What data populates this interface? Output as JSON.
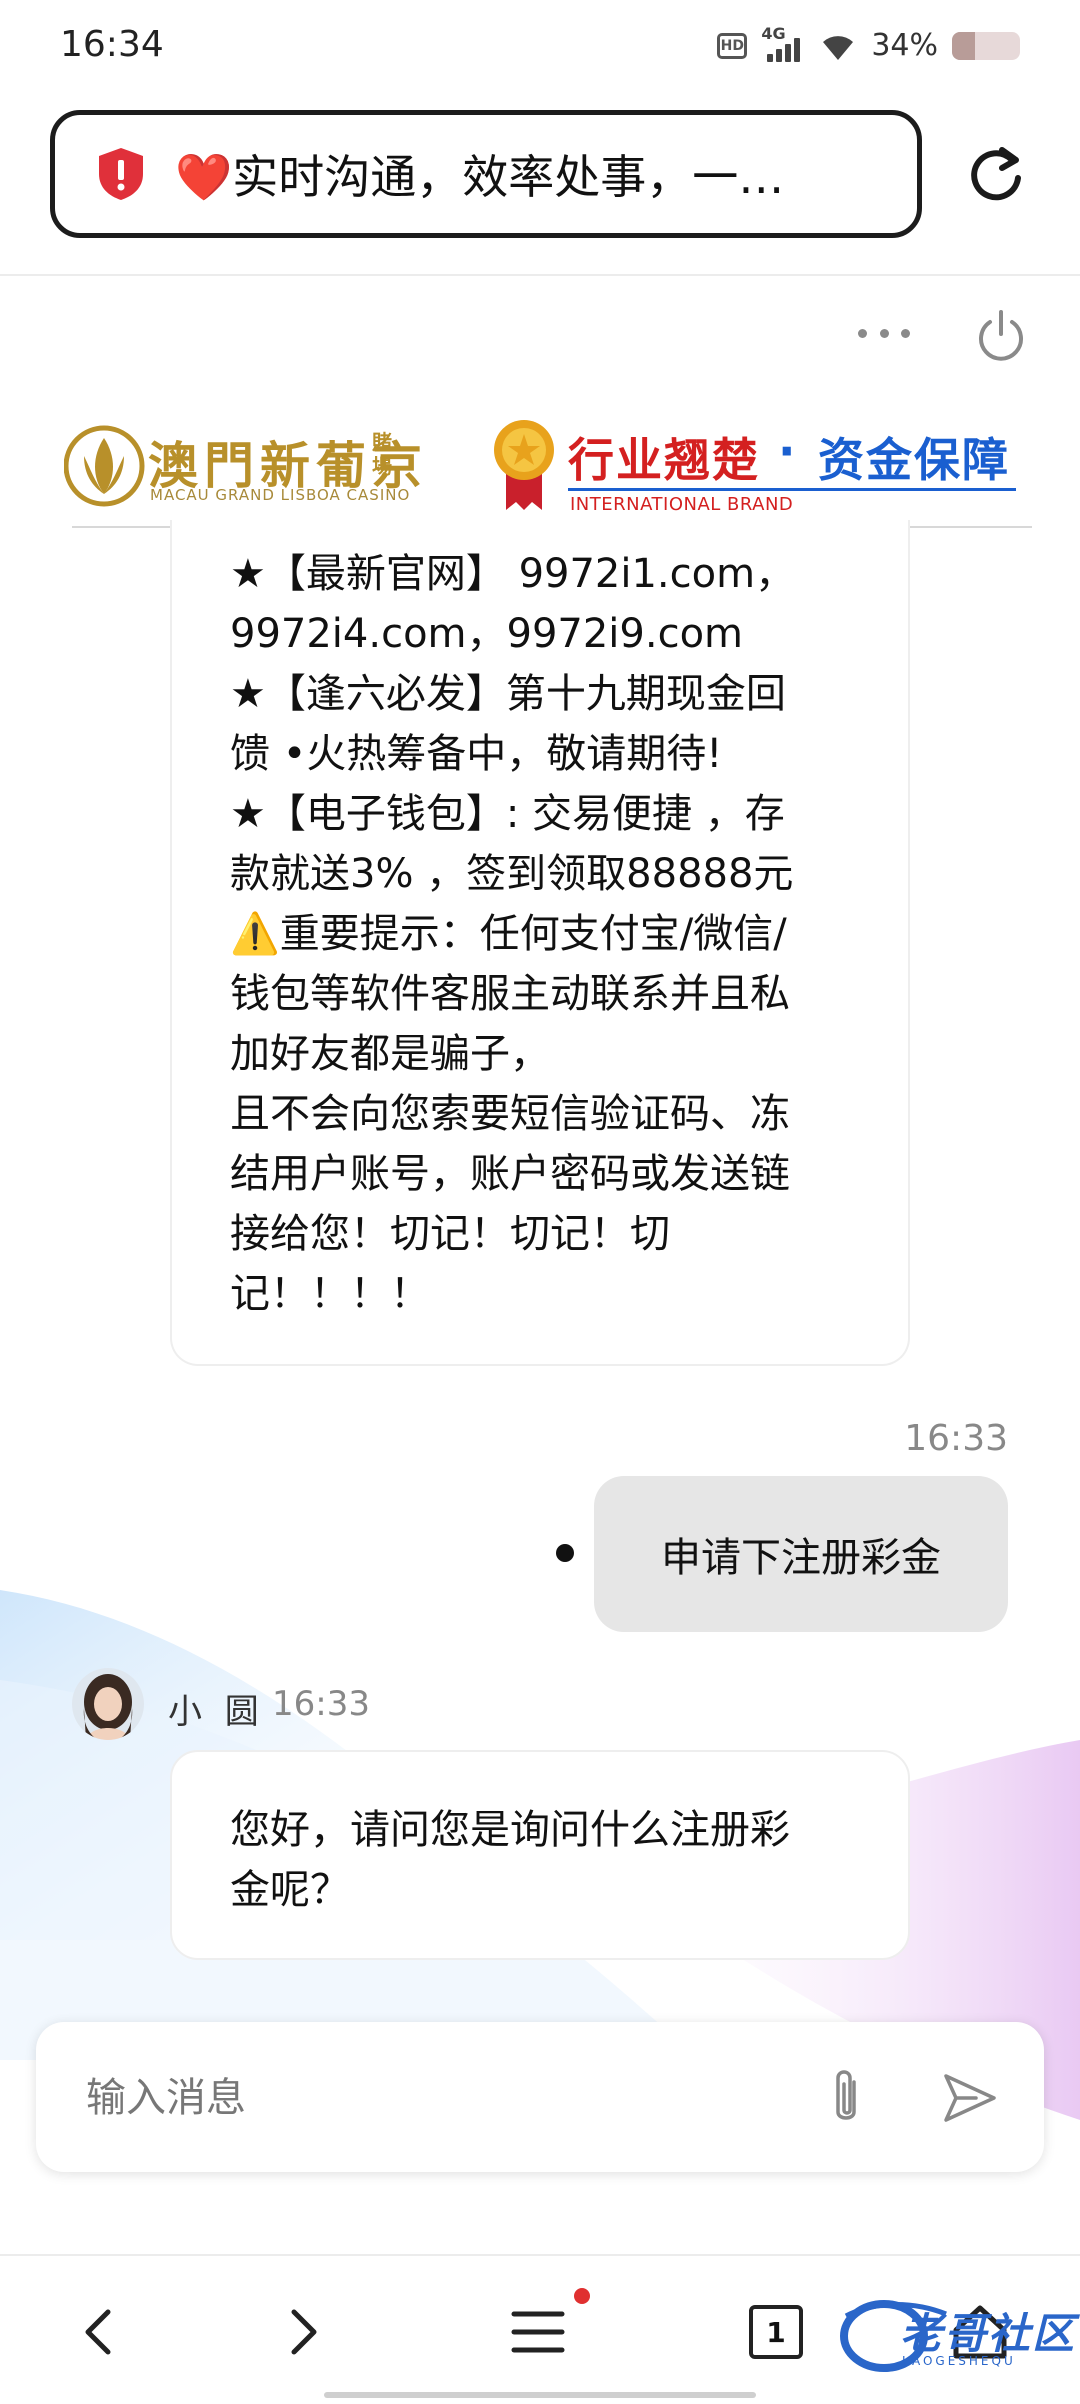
{
  "status_bar": {
    "time": "16:34",
    "hd": "HD",
    "network": "4G",
    "battery_percent": "34%",
    "battery_level": 0.34
  },
  "browser": {
    "url_heart": "❤️",
    "url_text": "实时沟通，效率处事，一…"
  },
  "banner": {
    "brand_cn": "澳門新葡京",
    "brand_cn_small": "賭場",
    "brand_en": "MACAU GRAND LISBOA CASINO",
    "slogan_a": "行业翘楚",
    "slogan_dot": "·",
    "slogan_b": "资金保障",
    "slogan_en": "INTERNATIONAL BRAND"
  },
  "messages": [
    {
      "direction": "incoming",
      "text": "★【最新官网】 9972i1.com，\n9972i4.com，9972i9.com\n★【逢六必发】第十九期现金回\n馈 •火热筹备中，敬请期待!\n★【电子钱包】: 交易便捷 ，存\n款就送3% ，签到领取88888元\n⚠️重要提示：任何支付宝/微信/\n钱包等软件客服主动联系并且私\n加好友都是骗子，\n且不会向您索要短信验证码、冻\n结用户账号，账户密码或发送链\n接给您！切记！切记！切\n记！！！！"
    },
    {
      "direction": "outgoing",
      "time": "16:33",
      "text": "申请下注册彩金"
    },
    {
      "direction": "incoming",
      "sender": "小 圆",
      "time": "16:33",
      "text": "您好，请问您是询问什么注册彩\n金呢？"
    }
  ],
  "composer": {
    "placeholder": "输入消息"
  },
  "nav": {
    "tab_count": "1"
  },
  "watermark": {
    "text": "老哥社区",
    "sub": "LAOGESHEQU"
  }
}
